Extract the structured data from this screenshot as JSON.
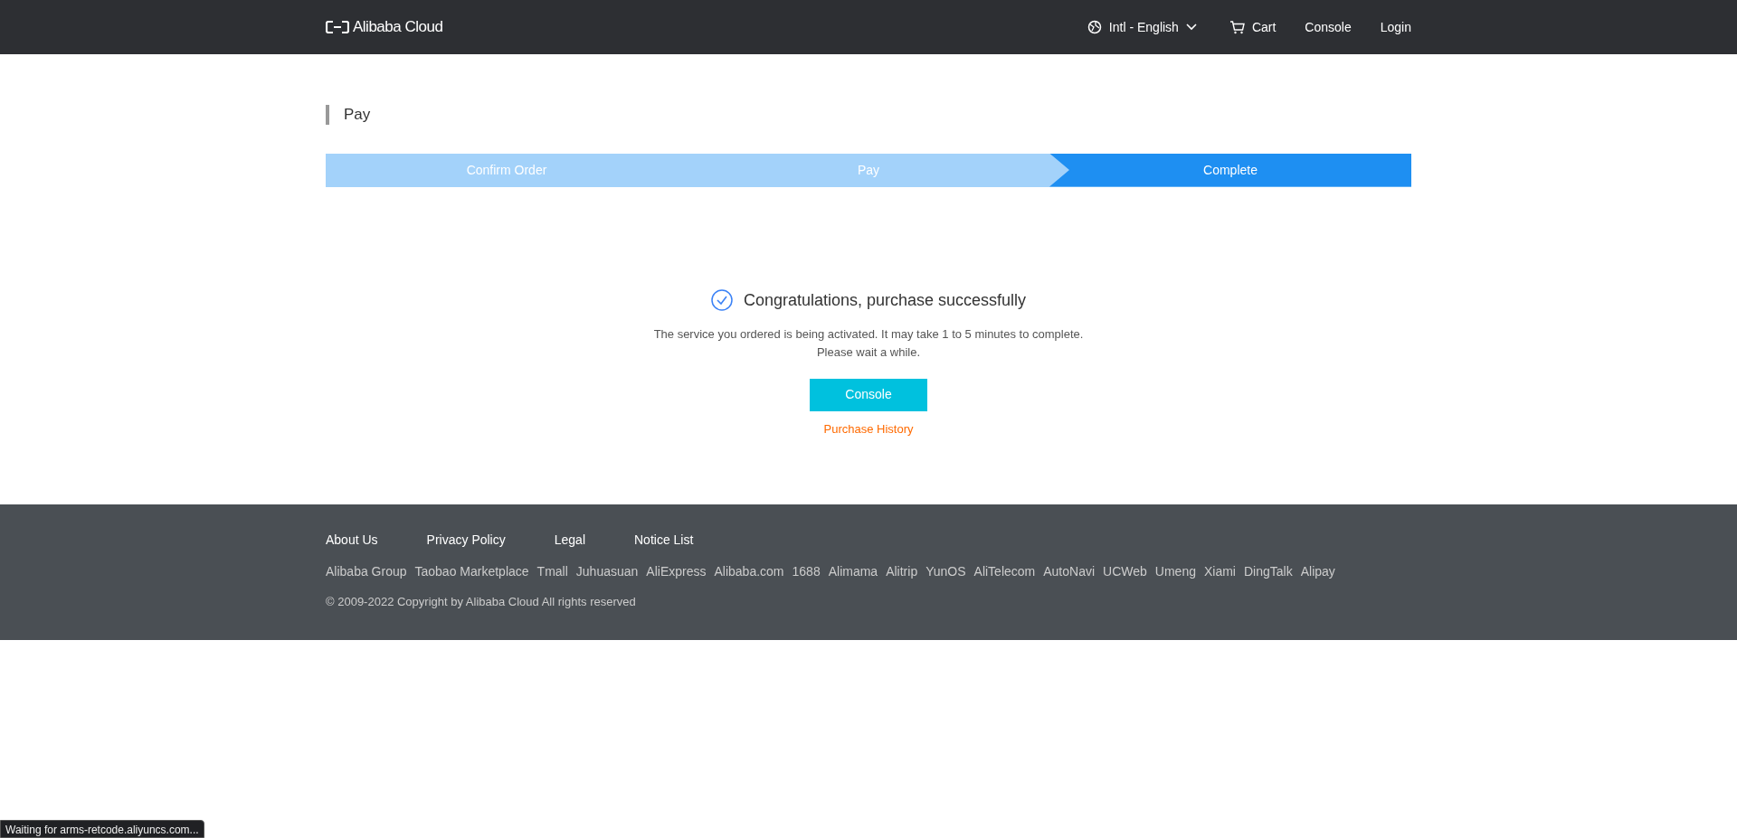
{
  "header": {
    "logo": "Alibaba Cloud",
    "language": "Intl - English",
    "nav": [
      "Cart",
      "Console",
      "Login"
    ]
  },
  "page_title": "Pay",
  "steps": [
    {
      "label": "Confirm Order",
      "selected": false
    },
    {
      "label": "Pay",
      "selected": false
    },
    {
      "label": "Complete",
      "selected": true
    }
  ],
  "result": {
    "title": "Congratulations, purchase successfully",
    "message": [
      "The service you ordered is being activated. It may take 1 to 5 minutes to complete.",
      "Please wait a while."
    ],
    "button": "Console",
    "link": "Purchase History"
  },
  "footer": {
    "links": [
      "About Us",
      "Privacy Policy",
      "Legal",
      "Notice List"
    ],
    "sites": [
      "Alibaba Group",
      "Taobao Marketplace",
      "Tmall",
      "Juhuasuan",
      "AliExpress",
      "Alibaba.com",
      "1688",
      "Alimama",
      "Alitrip",
      "YunOS",
      "AliTelecom",
      "AutoNavi",
      "UCWeb",
      "Umeng",
      "Xiami",
      "DingTalk",
      "Alipay"
    ],
    "copyright": "© 2009-2022 Copyright by Alibaba Cloud All rights reserved"
  },
  "status_bar": "Waiting for arms-retcode.aliyuncs.com..."
}
